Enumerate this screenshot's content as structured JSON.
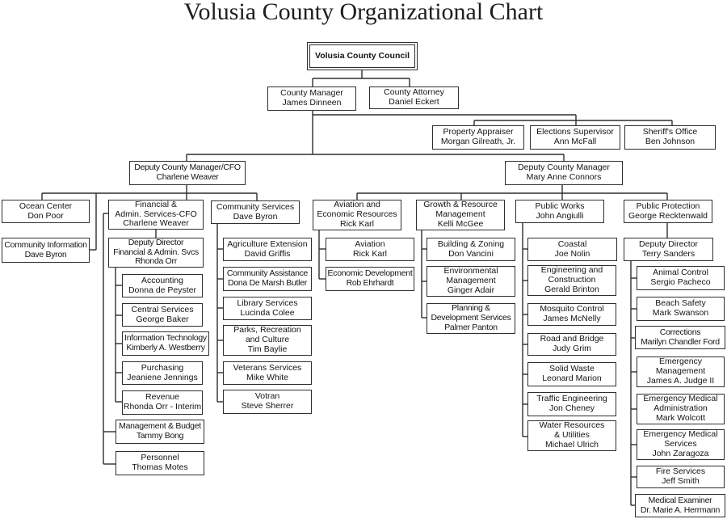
{
  "title": "Volusia County Organizational Chart",
  "council": {
    "title": "Volusia County Council"
  },
  "county_manager": {
    "title": "County Manager",
    "name": "James Dinneen"
  },
  "county_attorney": {
    "title": "County Attorney",
    "name": "Daniel Eckert"
  },
  "constitutional_officers": [
    {
      "title": "Property Appraiser",
      "name": "Morgan Gilreath, Jr."
    },
    {
      "title": "Elections Supervisor",
      "name": "Ann McFall"
    },
    {
      "title": "Sheriff's Office",
      "name": "Ben Johnson"
    }
  ],
  "deputy_cfo": {
    "title": "Deputy County Manager/CFO",
    "name": "Charlene Weaver",
    "ocean_center": {
      "title": "Ocean Center",
      "name": "Don Poor"
    },
    "community_information": {
      "title": "Community Information",
      "name": "Dave Byron"
    },
    "financial_admin": {
      "title": "Financial &\nAdmin. Services-CFO",
      "name": "Charlene Weaver",
      "deputy_director": {
        "title": "Deputy Director\nFinancial & Admin. Svcs",
        "name": "Rhonda Orr",
        "divisions": [
          {
            "title": "Accounting",
            "name": "Donna de Peyster"
          },
          {
            "title": "Central Services",
            "name": "George Baker"
          },
          {
            "title": "Information Technology",
            "name": "Kimberly A. Westberry"
          },
          {
            "title": "Purchasing",
            "name": "Jeaniene Jennings"
          },
          {
            "title": "Revenue",
            "name": "Rhonda Orr - Interim"
          }
        ]
      },
      "divisions": [
        {
          "title": "Management & Budget",
          "name": "Tammy Bong"
        },
        {
          "title": "Personnel",
          "name": "Thomas Motes"
        }
      ]
    },
    "community_services": {
      "title": "Community Services",
      "name": "Dave Byron",
      "divisions": [
        {
          "title": "Agriculture Extension",
          "name": "David Griffis"
        },
        {
          "title": "Community Assistance",
          "name": "Dona De Marsh Butler"
        },
        {
          "title": "Library Services",
          "name": "Lucinda Colee"
        },
        {
          "title": "Parks, Recreation\nand Culture",
          "name": "Tim Baylie"
        },
        {
          "title": "Veterans Services",
          "name": "Mike White"
        },
        {
          "title": "Votran",
          "name": "Steve Sherrer"
        }
      ]
    }
  },
  "deputy_cm": {
    "title": "Deputy County Manager",
    "name": "Mary Anne Connors",
    "departments": [
      {
        "title": "Aviation and\nEconomic Resources",
        "name": "Rick Karl",
        "divisions": [
          {
            "title": "Aviation",
            "name": "Rick Karl"
          },
          {
            "title": "Economic Development",
            "name": "Rob Ehrhardt"
          }
        ]
      },
      {
        "title": "Growth & Resource\nManagement",
        "name": "Kelli McGee",
        "divisions": [
          {
            "title": "Building & Zoning",
            "name": "Don Vancini"
          },
          {
            "title": "Environmental\nManagement",
            "name": "Ginger Adair"
          },
          {
            "title": "Planning &\nDevelopment Services",
            "name": "Palmer Panton"
          }
        ]
      },
      {
        "title": "Public Works",
        "name": "John Angiulli",
        "divisions": [
          {
            "title": "Coastal",
            "name": "Joe Nolin"
          },
          {
            "title": "Engineering and\nConstruction",
            "name": "Gerald Brinton"
          },
          {
            "title": "Mosquito Control",
            "name": "James McNelly"
          },
          {
            "title": "Road and Bridge",
            "name": "Judy Grim"
          },
          {
            "title": "Solid Waste",
            "name": "Leonard Marion"
          },
          {
            "title": "Traffic Engineering",
            "name": "Jon Cheney"
          },
          {
            "title": "Water Resources\n& Utilities",
            "name": "Michael Ulrich"
          }
        ]
      },
      {
        "title": "Public Protection",
        "name": "George Recktenwald",
        "deputy_director": {
          "title": "Deputy Director",
          "name": "Terry Sanders"
        },
        "divisions": [
          {
            "title": "Animal Control",
            "name": "Sergio Pacheco"
          },
          {
            "title": "Beach Safety",
            "name": "Mark Swanson"
          },
          {
            "title": "Corrections",
            "name": "Marilyn Chandler Ford"
          },
          {
            "title": "Emergency\nManagement",
            "name": "James A. Judge II"
          },
          {
            "title": "Emergency Medical\nAdministration",
            "name": "Mark Wolcott"
          },
          {
            "title": "Emergency Medical\nServices",
            "name": "John Zaragoza"
          },
          {
            "title": "Fire Services",
            "name": "Jeff Smith"
          },
          {
            "title": "Medical Examiner",
            "name": "Dr. Marie A. Herrmann"
          }
        ]
      }
    ]
  }
}
